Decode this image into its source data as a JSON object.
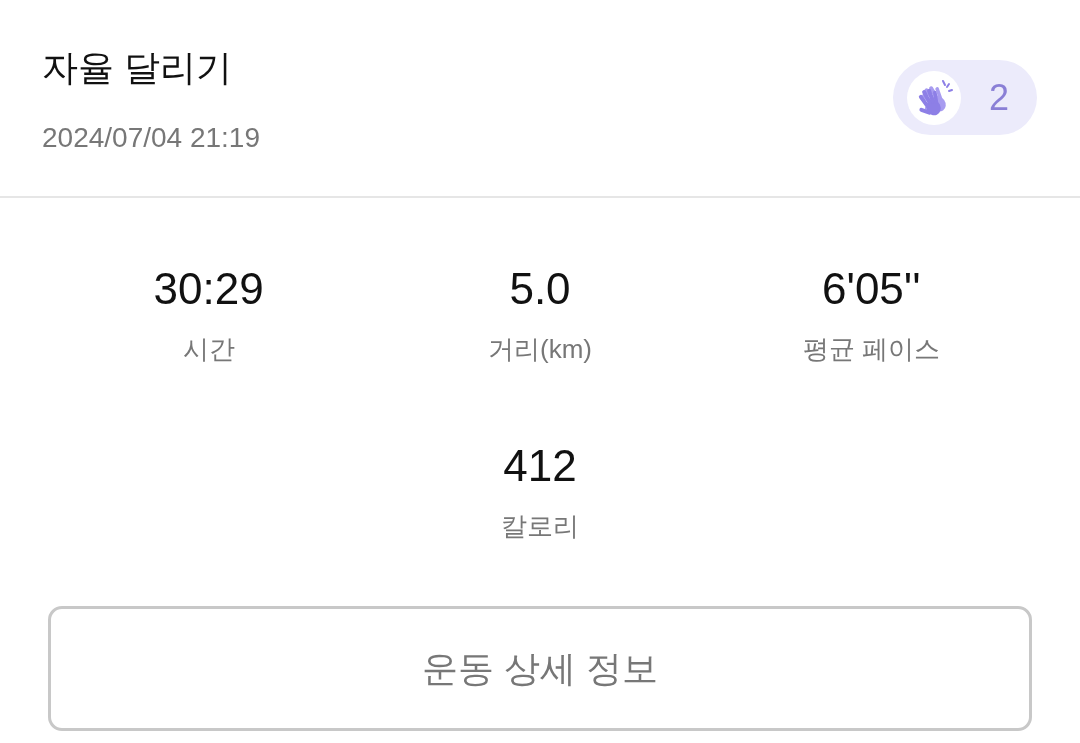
{
  "header": {
    "title": "자율 달리기",
    "date": "2024/07/04 21:19",
    "clap_badge": {
      "count": "2"
    }
  },
  "stats": [
    {
      "value": "30:29",
      "label": "시간"
    },
    {
      "value": "5.0",
      "label": "거리(km)"
    },
    {
      "value": "6'05''",
      "label": "평균 페이스"
    },
    {
      "value": "412",
      "label": "칼로리"
    }
  ],
  "detail_button": {
    "label": "운동 상세 정보"
  }
}
